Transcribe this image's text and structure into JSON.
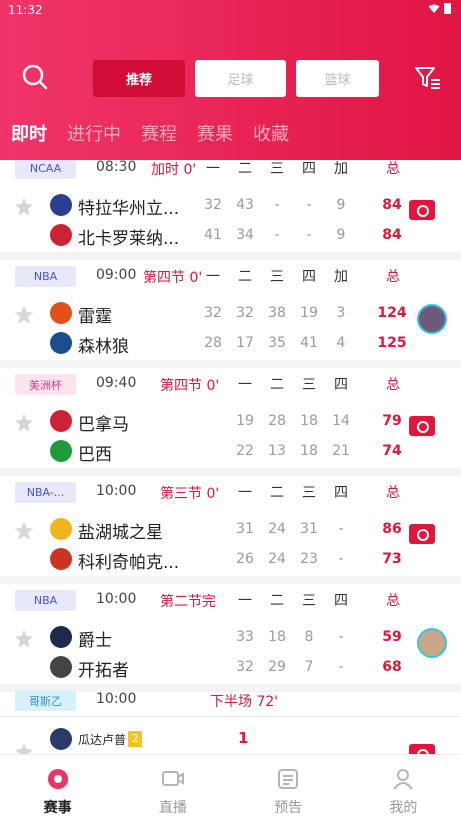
{
  "status_bar": {
    "time": "11:32"
  },
  "header": {
    "segments": [
      "推荐",
      "足球",
      "篮球"
    ],
    "tabs": [
      "即时",
      "进行中",
      "赛程",
      "赛果",
      "收藏"
    ]
  },
  "matches": [
    {
      "league": "NCAA",
      "league_style": "blue",
      "time": "08:30",
      "status": "加时 0'",
      "quarters": [
        "一",
        "二",
        "三",
        "四",
        "加"
      ],
      "total_label": "总",
      "teams": [
        {
          "name": "特拉华州立...",
          "scores": [
            "32",
            "43",
            "-",
            "-",
            "9"
          ],
          "total": "84"
        },
        {
          "name": "北卡罗莱纳...",
          "scores": [
            "41",
            "34",
            "-",
            "-",
            "9"
          ],
          "total": "84"
        }
      ],
      "indicator": "live"
    },
    {
      "league": "NBA",
      "league_style": "blue",
      "time": "09:00",
      "status": "第四节 0'",
      "quarters": [
        "一",
        "二",
        "三",
        "四",
        "加"
      ],
      "total_label": "总",
      "teams": [
        {
          "name": "雷霆",
          "scores": [
            "32",
            "32",
            "38",
            "19",
            "3"
          ],
          "total": "124"
        },
        {
          "name": "森林狼",
          "scores": [
            "28",
            "17",
            "35",
            "41",
            "4"
          ],
          "total": "125"
        }
      ],
      "indicator": "avatar"
    },
    {
      "league": "美洲杯",
      "league_style": "pink",
      "time": "09:40",
      "status": "第四节 0'",
      "quarters": [
        "一",
        "二",
        "三",
        "四"
      ],
      "total_label": "总",
      "teams": [
        {
          "name": "巴拿马",
          "scores": [
            "19",
            "28",
            "18",
            "14"
          ],
          "total": "79"
        },
        {
          "name": "巴西",
          "scores": [
            "22",
            "13",
            "18",
            "21"
          ],
          "total": "74"
        }
      ],
      "indicator": "live"
    },
    {
      "league": "NBA-...",
      "league_style": "blue",
      "time": "10:00",
      "status": "第三节 0'",
      "quarters": [
        "一",
        "二",
        "三",
        "四"
      ],
      "total_label": "总",
      "teams": [
        {
          "name": "盐湖城之星",
          "scores": [
            "31",
            "24",
            "31",
            "-"
          ],
          "total": "86"
        },
        {
          "name": "科利奇帕克...",
          "scores": [
            "26",
            "24",
            "23",
            "-"
          ],
          "total": "73"
        }
      ],
      "indicator": "live"
    },
    {
      "league": "NBA",
      "league_style": "blue",
      "time": "10:00",
      "status": "第二节完",
      "quarters": [
        "一",
        "二",
        "三",
        "四"
      ],
      "total_label": "总",
      "teams": [
        {
          "name": "爵士",
          "scores": [
            "33",
            "18",
            "8",
            "-"
          ],
          "total": "59"
        },
        {
          "name": "开拓者",
          "scores": [
            "32",
            "29",
            "7",
            "-"
          ],
          "total": "68"
        }
      ],
      "indicator": "avatar"
    }
  ],
  "soccer_match": {
    "league": "哥斯乙",
    "time": "10:00",
    "status": "下半场 72'",
    "home_team": "瓜达卢普",
    "home_badge": "2",
    "home_score": "1"
  },
  "bottom_nav": [
    "赛事",
    "直播",
    "预告",
    "我的"
  ]
}
